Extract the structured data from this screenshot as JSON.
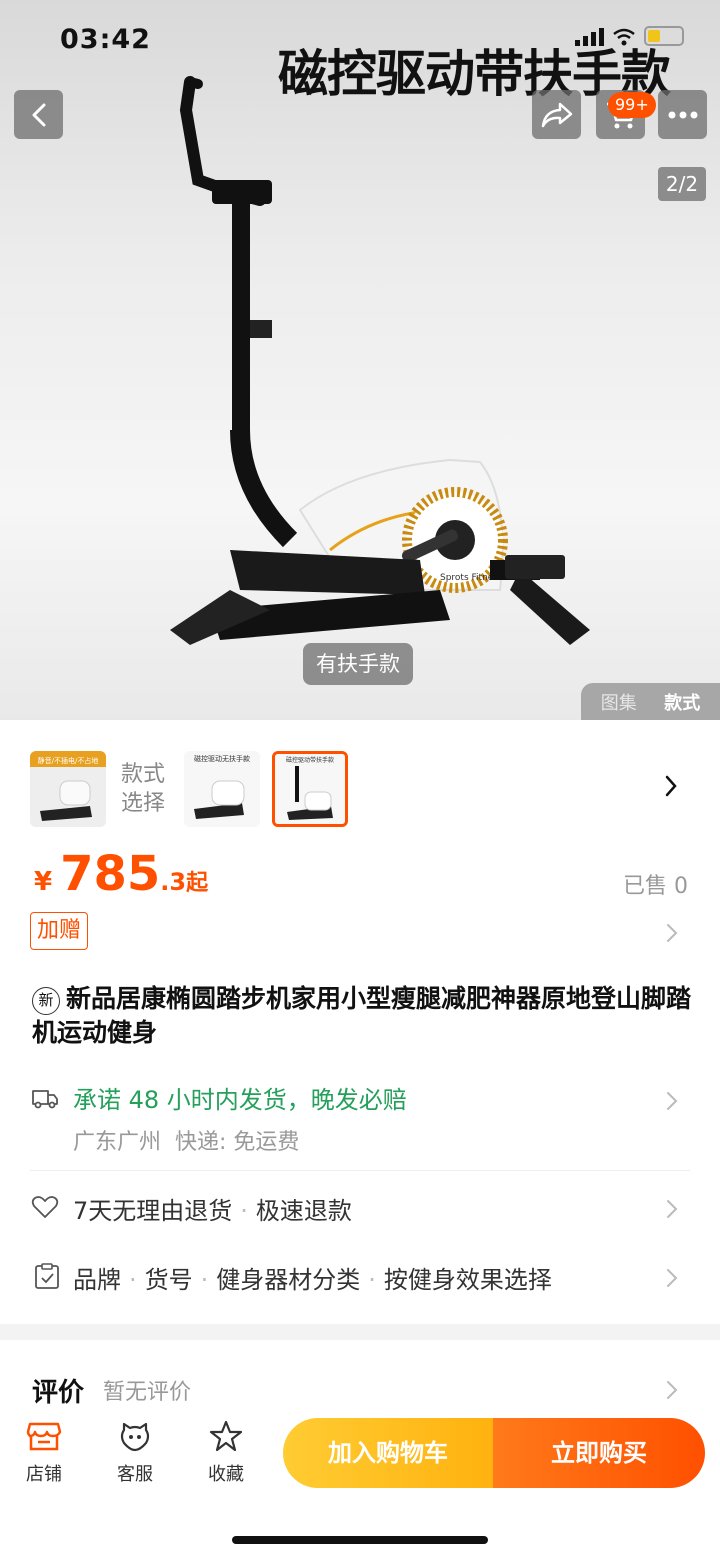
{
  "status": {
    "time": "03:42"
  },
  "hero": {
    "title": "磁控驱动带扶手款",
    "cart_badge": "99+",
    "page_indicator": "2/2",
    "variant_label": "有扶手款",
    "tabs": [
      "图集",
      "款式"
    ],
    "active_tab": "款式",
    "product_label": "Sprots Fitness"
  },
  "variants": {
    "select_label": "款式选择",
    "thumbs": [
      {
        "caption": "静音/不插电/不占地"
      },
      {
        "caption": "磁控驱动无扶手款"
      },
      {
        "caption": "磁控驱动带扶手款",
        "selected": true
      }
    ]
  },
  "price": {
    "currency": "¥",
    "integer": "785",
    "decimal": ".3",
    "suffix": "起",
    "sold": "已售 0",
    "gift_tag": "加赠"
  },
  "product": {
    "new_badge": "新",
    "title": "新品居康椭圆踏步机家用小型瘦腿减肥神器原地登山脚踏机运动健身"
  },
  "shipping": {
    "promise": "承诺 48 小时内发货，晚发必赔",
    "origin": "广东广州",
    "express": "快递: 免运费"
  },
  "returns": {
    "policy": "7天无理由退货",
    "refund": "极速退款"
  },
  "params": [
    "品牌",
    "货号",
    "健身器材分类",
    "按健身效果选择"
  ],
  "reviews": {
    "title": "评价",
    "status": "暂无评价"
  },
  "bottom_bar": {
    "shop": "店铺",
    "service": "客服",
    "favorite": "收藏",
    "add_to_cart": "加入购物车",
    "buy_now": "立即购买"
  },
  "colors": {
    "accent": "#ff5000",
    "cart_gradient": "#ffc21f",
    "shipping_green": "#24a05b"
  }
}
